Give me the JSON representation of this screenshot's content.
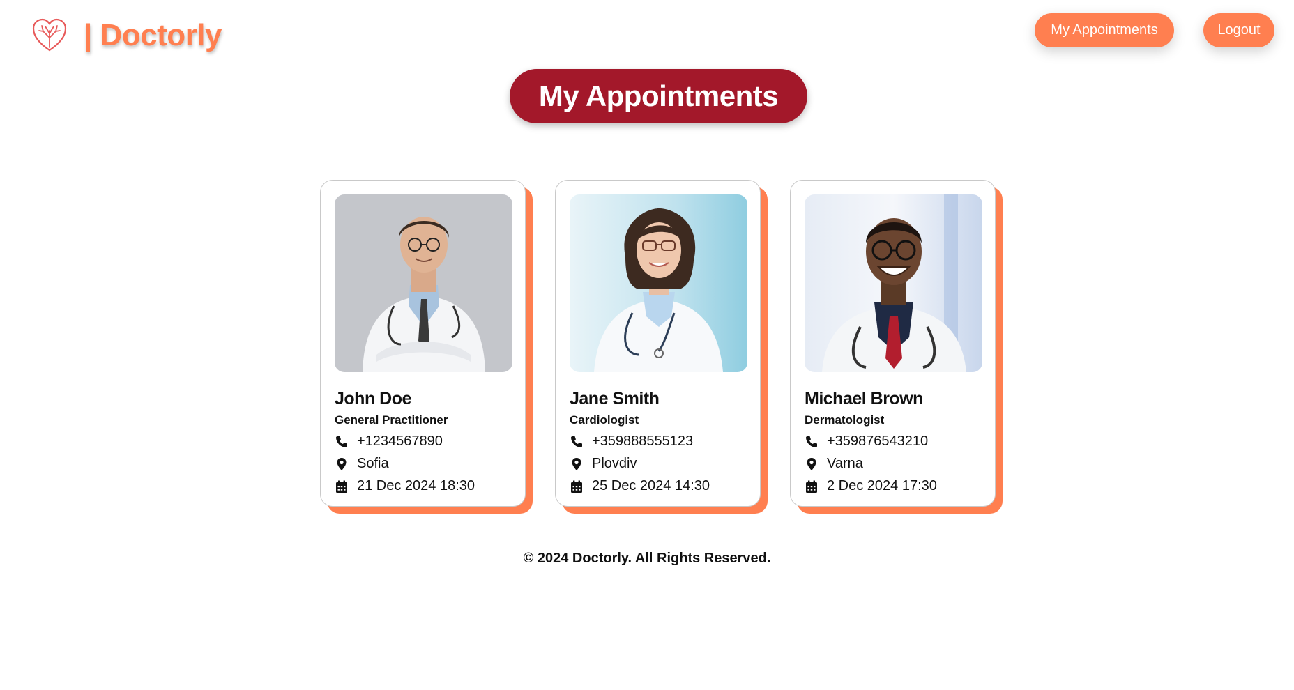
{
  "header": {
    "brand_name": "| Doctorly",
    "logo_icon": "heart-tree-icon",
    "nav": {
      "appointments_label": "My Appointments",
      "logout_label": "Logout"
    }
  },
  "page_title": "My Appointments",
  "colors": {
    "accent": "#ff7f50",
    "title_bg": "#a3182a"
  },
  "appointments": [
    {
      "name": "John Doe",
      "specialty": "General Practitioner",
      "phone": "+1234567890",
      "city": "Sofia",
      "datetime": "21 Dec 2024 18:30"
    },
    {
      "name": "Jane Smith",
      "specialty": "Cardiologist",
      "phone": "+359888555123",
      "city": "Plovdiv",
      "datetime": "25 Dec 2024 14:30"
    },
    {
      "name": "Michael Brown",
      "specialty": "Dermatologist",
      "phone": "+359876543210",
      "city": "Varna",
      "datetime": "2 Dec 2024 17:30"
    }
  ],
  "footer": {
    "copyright": "© 2024 Doctorly. All Rights Reserved."
  }
}
